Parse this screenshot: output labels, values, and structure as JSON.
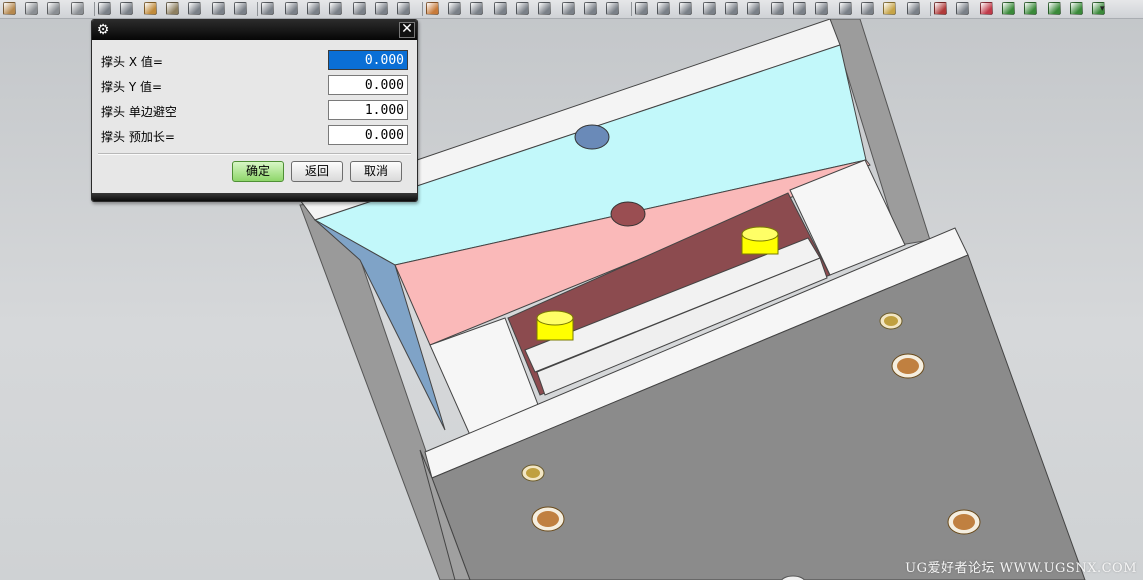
{
  "toolbar": {
    "icons": [
      {
        "name": "block-icon",
        "color": "#b5884e"
      },
      {
        "name": "cylinder-icon",
        "color": "#8a8e93"
      },
      {
        "name": "cone-icon",
        "color": "#8a8e93"
      },
      {
        "name": "sphere-icon",
        "color": "#8a8e93"
      },
      {
        "name": "extrude-icon",
        "color": "#7a8088"
      },
      {
        "name": "revolve-icon",
        "color": "#7a8088"
      },
      {
        "name": "pattern-icon",
        "color": "#c08a3a"
      },
      {
        "name": "unite-icon",
        "color": "#8d7f60"
      },
      {
        "name": "subtract-icon",
        "color": "#7a8088"
      },
      {
        "name": "intersect-icon",
        "color": "#7a8088"
      },
      {
        "name": "hole-icon",
        "color": "#7a8088"
      },
      {
        "name": "boss-icon",
        "color": "#7a8088"
      },
      {
        "name": "pocket-icon",
        "color": "#7a8088"
      },
      {
        "name": "pad-icon",
        "color": "#7a8088"
      },
      {
        "name": "slot-icon",
        "color": "#7a8088"
      },
      {
        "name": "groove-icon",
        "color": "#7a8088"
      },
      {
        "name": "rib-icon",
        "color": "#7a8088"
      },
      {
        "name": "blend-icon",
        "color": "#7a8088"
      },
      {
        "name": "chamfer-icon",
        "color": "#c77a3a"
      },
      {
        "name": "shell-icon",
        "color": "#7a8088"
      },
      {
        "name": "trim-body-icon",
        "color": "#7a8088"
      },
      {
        "name": "split-body-icon",
        "color": "#7a8088"
      },
      {
        "name": "offset-face-icon",
        "color": "#7a8088"
      },
      {
        "name": "draft-icon",
        "color": "#7a8088"
      },
      {
        "name": "thicken-icon",
        "color": "#7a8088"
      },
      {
        "name": "sew-icon",
        "color": "#7a8088"
      },
      {
        "name": "patch-icon",
        "color": "#7a8088"
      },
      {
        "name": "view-front-icon",
        "color": "#7a8088"
      },
      {
        "name": "view-top-icon",
        "color": "#7a8088"
      },
      {
        "name": "view-right-icon",
        "color": "#7a8088"
      },
      {
        "name": "view-iso-icon",
        "color": "#7a8088"
      },
      {
        "name": "view-trimetric-icon",
        "color": "#7a8088"
      },
      {
        "name": "shaded-icon",
        "color": "#7a8088"
      },
      {
        "name": "wireframe-icon",
        "color": "#7a8088"
      },
      {
        "name": "studio-icon",
        "color": "#7a8088"
      },
      {
        "name": "face-analysis-icon",
        "color": "#7a8088"
      },
      {
        "name": "section-icon",
        "color": "#7a8088"
      },
      {
        "name": "cone-view-icon",
        "color": "#7a8088"
      },
      {
        "name": "material-icon",
        "color": "#c6a447"
      },
      {
        "name": "render-icon",
        "color": "#7a8088"
      },
      {
        "name": "layer-settings-icon",
        "color": "#b03a3a"
      },
      {
        "name": "layer-visible-icon",
        "color": "#7a8088"
      },
      {
        "name": "layer-move-icon",
        "color": "#c03a4a"
      },
      {
        "name": "layer-copy-icon",
        "color": "#3a8a3a"
      },
      {
        "name": "assembly-icon",
        "color": "#3a8a3a"
      },
      {
        "name": "component-icon",
        "color": "#3a8a3a"
      },
      {
        "name": "constraint-icon",
        "color": "#3a8a3a"
      },
      {
        "name": "explode-icon",
        "color": "#3a8a3a"
      }
    ]
  },
  "dialog": {
    "rows": [
      {
        "label": "撑头 X 值=",
        "value": "0.000"
      },
      {
        "label": "撑头 Y 值=",
        "value": "0.000"
      },
      {
        "label": "撑头 单边避空",
        "value": "1.000"
      },
      {
        "label": "撑头 预加长=",
        "value": "0.000"
      }
    ],
    "ok_label": "确定",
    "back_label": "返回",
    "cancel_label": "取消",
    "close_glyph": "✕",
    "gear_glyph": "⚙"
  },
  "watermark": "UG爱好者论坛 WWW.UGSNX.COM",
  "colors": {
    "plate_cyan": "#c2f8fa",
    "plate_pink": "#fab9b9",
    "pocket_dark": "#8c4b4f",
    "plate_gray": "#8b8b8b",
    "plate_white": "#f4f4f4",
    "pin_yellow": "#ffff00",
    "screw_bronze": "#c08040",
    "selection_blue": "#0a6fd6",
    "ok_green": "#8ed66a"
  }
}
